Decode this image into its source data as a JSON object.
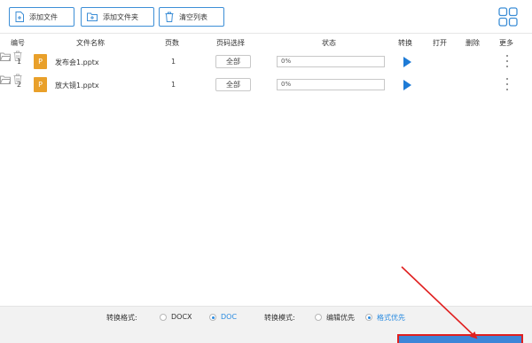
{
  "toolbar": {
    "add_file": "添加文件",
    "add_folder": "添加文件夹",
    "clear_list": "清空列表"
  },
  "table": {
    "headers": {
      "num": "编号",
      "name": "文件名称",
      "pages": "页数",
      "page_select": "页码选择",
      "status": "状态",
      "convert": "转换",
      "open": "打开",
      "delete": "删除",
      "more": "更多"
    },
    "rows": [
      {
        "num": "1",
        "icon_letter": "P",
        "name": "发布会1.pptx",
        "pages": "1",
        "page_select": "全部",
        "progress": "0%"
      },
      {
        "num": "2",
        "icon_letter": "P",
        "name": "放大镜1.pptx",
        "pages": "1",
        "page_select": "全部",
        "progress": "0%"
      }
    ]
  },
  "bottom": {
    "format_label": "转换格式:",
    "format_docx": "DOCX",
    "format_doc": "DOC",
    "format_selected": "DOC",
    "mode_label": "转换模式:",
    "mode_edit": "编辑优先",
    "mode_format": "格式优先",
    "mode_selected": "格式优先"
  },
  "colors": {
    "accent": "#1e7bd6",
    "file_icon": "#e9a02a",
    "highlight": "#e02020"
  }
}
